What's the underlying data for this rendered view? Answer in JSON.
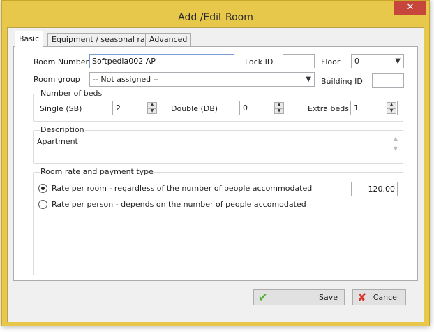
{
  "window": {
    "title": "Add /Edit Room",
    "close_glyph": "✕"
  },
  "tabs": [
    {
      "label": "Basic",
      "active": true
    },
    {
      "label": "Equipment / seasonal rates",
      "active": false
    },
    {
      "label": "Advanced",
      "active": false
    }
  ],
  "basic": {
    "room_number_label": "Room Number",
    "room_number_value": "Softpedia002 AP",
    "lock_id_label": "Lock ID",
    "lock_id_value": "",
    "floor_label": "Floor",
    "floor_value": "0",
    "room_group_label": "Room group",
    "room_group_value": "-- Not assigned --",
    "building_id_label": "Building ID",
    "building_id_value": ""
  },
  "beds": {
    "group_label": "Number of beds",
    "single_label": "Single (SB)",
    "single_value": "2",
    "double_label": "Double (DB)",
    "double_value": "0",
    "extra_label": "Extra beds",
    "extra_value": "1"
  },
  "description": {
    "group_label": "Description",
    "text": "Apartment"
  },
  "rate": {
    "group_label": "Room rate and payment type",
    "per_room_label": "Rate per room - regardless of the number of people accommodated",
    "per_room_checked": true,
    "per_person_label": "Rate per person - depends on the number of people accomodated",
    "per_person_checked": false,
    "amount": "120.00"
  },
  "buttons": {
    "save": "Save",
    "cancel": "Cancel"
  },
  "icons": {
    "save": "check-icon",
    "cancel": "cross-icon",
    "combo": "chevron-down-icon",
    "spin_up": "spin-up-icon",
    "spin_down": "spin-down-icon"
  },
  "colors": {
    "title_bar": "#e8c84a",
    "close_button": "#c7463b",
    "save_icon": "#4caf2f",
    "cancel_icon": "#d9342b"
  }
}
